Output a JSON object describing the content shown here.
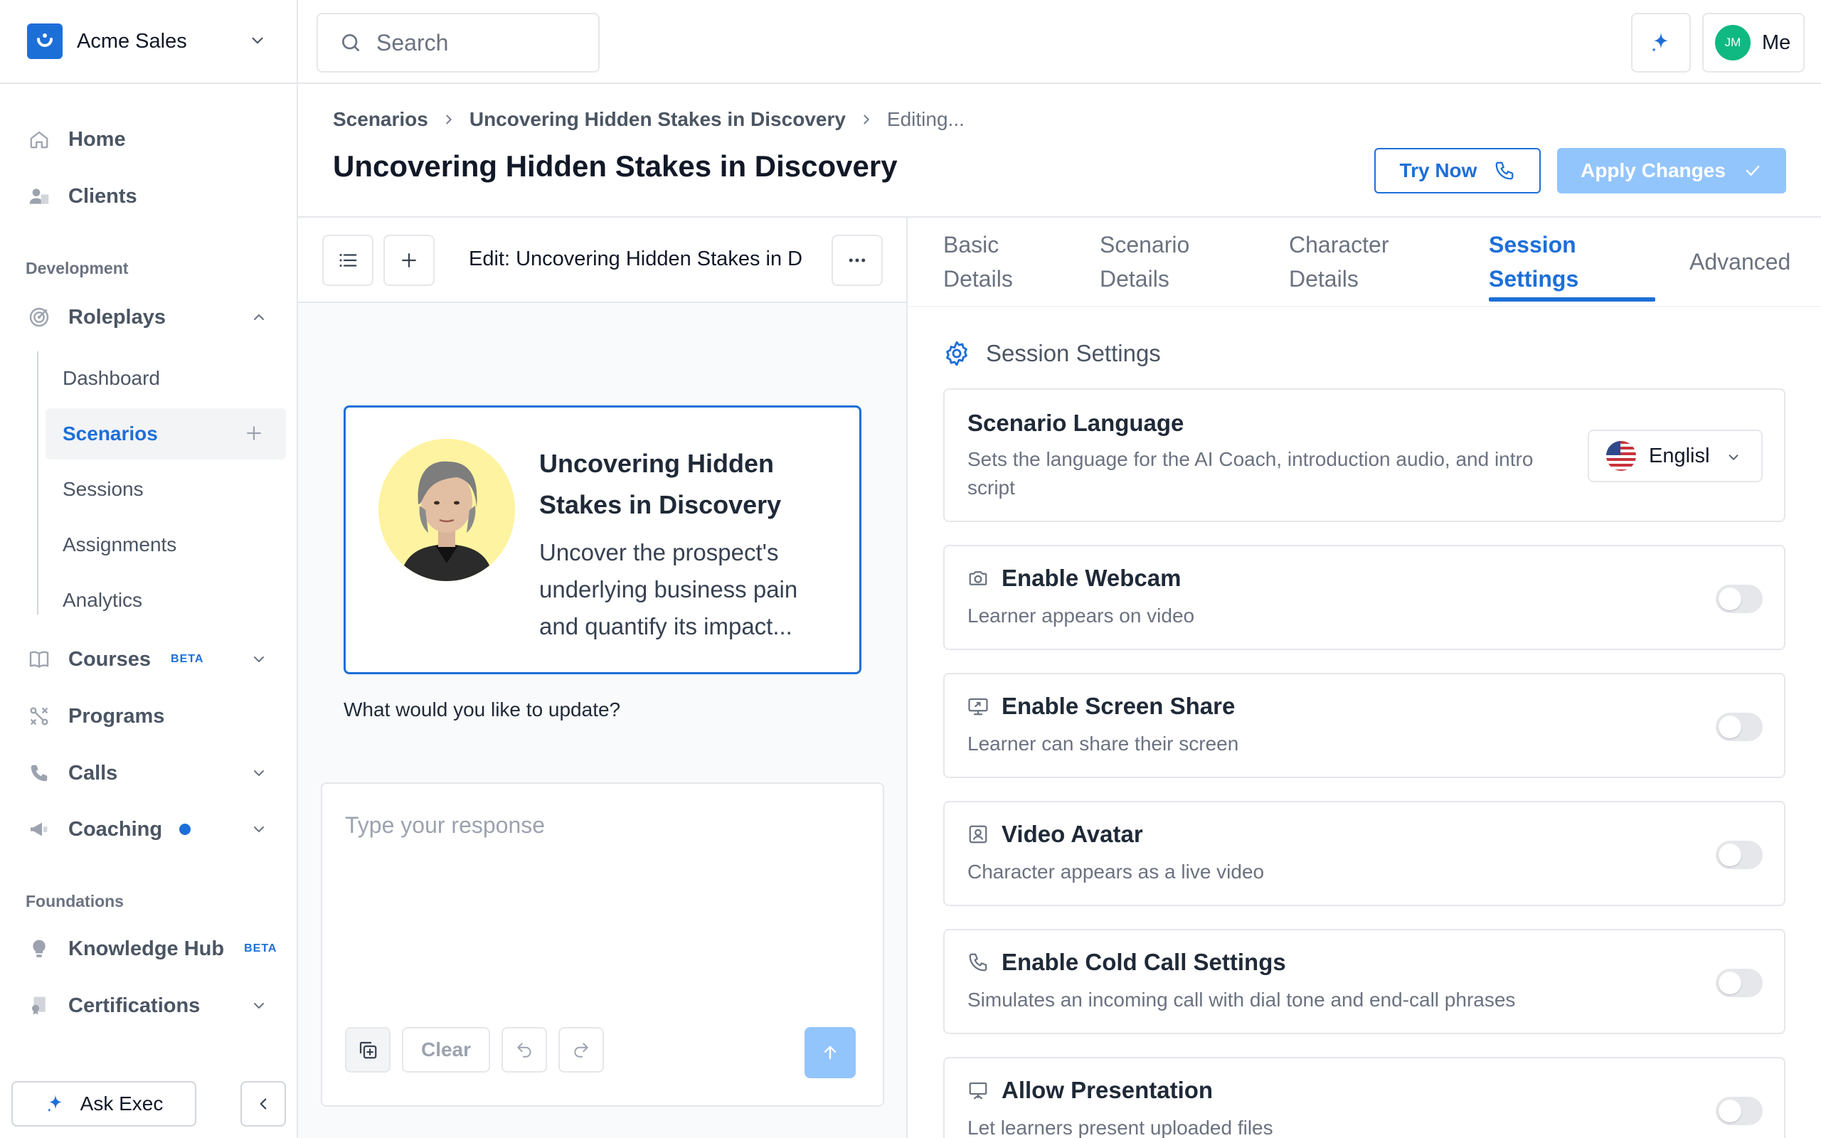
{
  "org": {
    "name": "Acme Sales"
  },
  "search": {
    "placeholder": "Search"
  },
  "user": {
    "initials": "JM",
    "label": "Me"
  },
  "nav": {
    "home": "Home",
    "clients": "Clients",
    "section_development": "Development",
    "roleplays": "Roleplays",
    "roleplays_sub": [
      "Dashboard",
      "Scenarios",
      "Sessions",
      "Assignments",
      "Analytics"
    ],
    "courses": "Courses",
    "courses_badge": "BETA",
    "programs": "Programs",
    "calls": "Calls",
    "coaching": "Coaching",
    "section_foundations": "Foundations",
    "knowledge_hub": "Knowledge Hub",
    "knowledge_hub_badge": "BETA",
    "certifications": "Certifications"
  },
  "sidebar_bottom": {
    "ask_exec": "Ask Exec"
  },
  "breadcrumb": {
    "root": "Scenarios",
    "scenario": "Uncovering Hidden Stakes in Discovery",
    "current": "Editing..."
  },
  "page": {
    "title": "Uncovering Hidden Stakes in Discovery",
    "try_now": "Try Now",
    "apply_changes": "Apply Changes"
  },
  "editor": {
    "title": "Edit: Uncovering Hidden Stakes in D",
    "card_title": "Uncovering Hidden Stakes in Discovery",
    "card_desc": "Uncover the prospect's underlying business pain and quantify its impact...",
    "prompt": "What would you like to update?",
    "input_placeholder": "Type your response",
    "clear": "Clear"
  },
  "tabs": [
    {
      "line1": "Basic",
      "line2": "Details"
    },
    {
      "line1": "Scenario",
      "line2": "Details"
    },
    {
      "line1": "Character",
      "line2": "Details"
    },
    {
      "line1": "Session",
      "line2": "Settings"
    },
    {
      "line1": "Advanced",
      "line2": ""
    }
  ],
  "active_tab": "Session Settings",
  "settings": {
    "section_title": "Session Settings",
    "language": {
      "title": "Scenario Language",
      "desc": "Sets the language for the AI Coach, introduction audio, and intro script",
      "value": "English"
    },
    "items": [
      {
        "title": "Enable Webcam",
        "desc": "Learner appears on video",
        "enabled": false,
        "icon": "camera-icon"
      },
      {
        "title": "Enable Screen Share",
        "desc": "Learner can share their screen",
        "enabled": false,
        "icon": "screen-share-icon"
      },
      {
        "title": "Video Avatar",
        "desc": "Character appears as a live video",
        "enabled": false,
        "icon": "portrait-icon"
      },
      {
        "title": "Enable Cold Call Settings",
        "desc": "Simulates an incoming call with dial tone and end-call phrases",
        "enabled": false,
        "icon": "phone-icon"
      },
      {
        "title": "Allow Presentation",
        "desc": "Let learners present uploaded files",
        "enabled": false,
        "icon": "presentation-icon"
      }
    ]
  },
  "colors": {
    "accent": "#1d6fd8",
    "accent_disabled": "#93c5fd",
    "avatar_bg": "#10b981"
  }
}
